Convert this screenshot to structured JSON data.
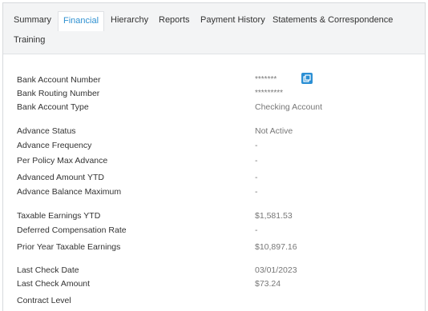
{
  "tabs": [
    {
      "label": "Summary"
    },
    {
      "label": "Financial"
    },
    {
      "label": "Hierarchy"
    },
    {
      "label": "Reports"
    },
    {
      "label": "Payment History"
    },
    {
      "label": "Statements & Correspondence"
    },
    {
      "label": "Training"
    }
  ],
  "fields": {
    "bank_account_number": {
      "label": "Bank Account Number",
      "value": "*******"
    },
    "bank_routing_number": {
      "label": "Bank Routing Number",
      "value": "*********"
    },
    "bank_account_type": {
      "label": "Bank Account Type",
      "value": "Checking Account"
    },
    "advance_status": {
      "label": "Advance Status",
      "value": "Not Active"
    },
    "advance_frequency": {
      "label": "Advance Frequency",
      "value": "-"
    },
    "per_policy_max_advance": {
      "label": "Per Policy Max Advance",
      "value": "-"
    },
    "advanced_amount_ytd": {
      "label": "Advanced Amount YTD",
      "value": "-"
    },
    "advance_balance_maximum": {
      "label": "Advance Balance Maximum",
      "value": "-"
    },
    "taxable_earnings_ytd": {
      "label": "Taxable Earnings YTD",
      "value": "$1,581.53"
    },
    "deferred_compensation_rate": {
      "label": "Deferred Compensation Rate",
      "value": "-"
    },
    "prior_year_taxable_earnings": {
      "label": "Prior Year Taxable Earnings",
      "value": "$10,897.16"
    },
    "last_check_date": {
      "label": "Last Check Date",
      "value": "03/01/2023"
    },
    "last_check_amount": {
      "label": "Last Check Amount",
      "value": "$73.24"
    },
    "contract_level": {
      "label": "Contract Level",
      "value": ""
    }
  },
  "colors": {
    "accent": "#2f91d1",
    "label": "#333333",
    "value": "#777777",
    "tab_bg": "#f3f4f5"
  },
  "icons": {
    "reveal": "reveal-account-number-icon"
  }
}
